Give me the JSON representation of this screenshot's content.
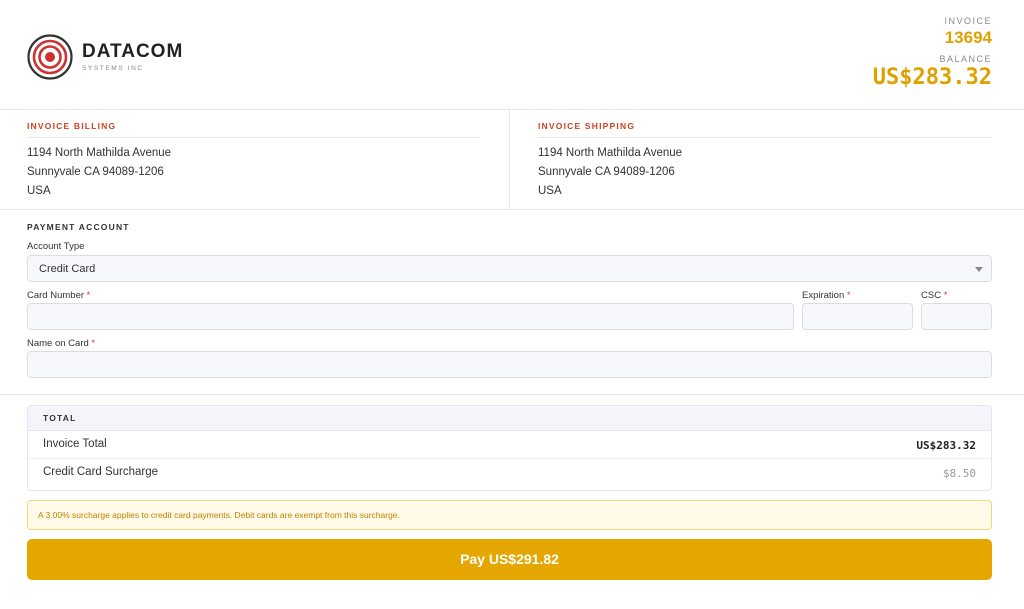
{
  "brand": {
    "name": "DATACOM",
    "subtitle": "SYSTEMS INC",
    "icon": "target-logo-icon"
  },
  "invoice": {
    "invoice_label": "INVOICE",
    "invoice_number": "13694",
    "balance_label": "BALANCE",
    "balance_value": "US$283.32"
  },
  "billing": {
    "title": "INVOICE BILLING",
    "lines": [
      "1194 North Mathilda Avenue",
      "Sunnyvale CA 94089-1206",
      "USA"
    ]
  },
  "shipping": {
    "title": "INVOICE SHIPPING",
    "lines": [
      "1194 North Mathilda Avenue",
      "Sunnyvale CA 94089-1206",
      "USA"
    ]
  },
  "payment": {
    "title": "PAYMENT ACCOUNT",
    "account_type_label": "Account Type",
    "account_type_value": "Credit Card",
    "card_number_label": "Card Number",
    "expiration_label": "Expiration",
    "csc_label": "CSC",
    "name_on_card_label": "Name on Card",
    "required_mark": "*",
    "card_number_value": "",
    "expiration_value": "",
    "csc_value": "",
    "name_on_card_value": ""
  },
  "totals": {
    "title": "TOTAL",
    "rows": [
      {
        "label": "Invoice Total",
        "value": "US$283.32"
      },
      {
        "label": "Credit Card Surcharge",
        "value": "$8.50"
      }
    ]
  },
  "notice": "A 3.00% surcharge applies to credit card payments. Debit cards are exempt from this surcharge.",
  "pay_button": "Pay US$291.82",
  "colors": {
    "accent": "#e6a600",
    "section_title": "#d04020",
    "notice_bg": "#fffbe8"
  }
}
